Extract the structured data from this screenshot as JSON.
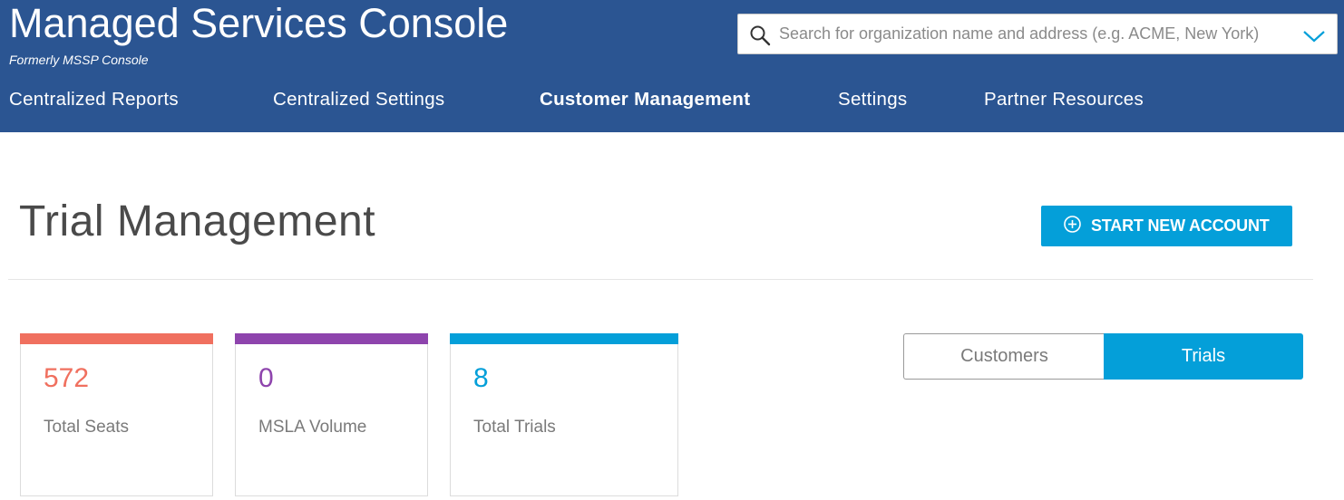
{
  "header": {
    "title": "Managed Services Console",
    "subtitle": "Formerly MSSP Console",
    "search": {
      "placeholder": "Search for organization name and address (e.g. ACME, New York)",
      "value": ""
    }
  },
  "nav": {
    "items": [
      {
        "label": "Centralized Reports"
      },
      {
        "label": "Centralized Settings"
      },
      {
        "label": "Customer Management",
        "active": true
      },
      {
        "label": "Settings"
      },
      {
        "label": "Partner Resources"
      }
    ]
  },
  "main": {
    "title": "Trial Management",
    "start_button_label": "START NEW ACCOUNT",
    "stats": [
      {
        "value": "572",
        "label": "Total Seats",
        "color": "#f0705f"
      },
      {
        "value": "0",
        "label": "MSLA Volume",
        "color": "#8e44ad"
      },
      {
        "value": "8",
        "label": "Total Trials",
        "color": "#049fd9"
      }
    ],
    "toggle": {
      "options": [
        "Customers",
        "Trials"
      ],
      "selected": "Trials"
    }
  },
  "colors": {
    "header_bg": "#2b5592",
    "accent": "#049fd9"
  }
}
